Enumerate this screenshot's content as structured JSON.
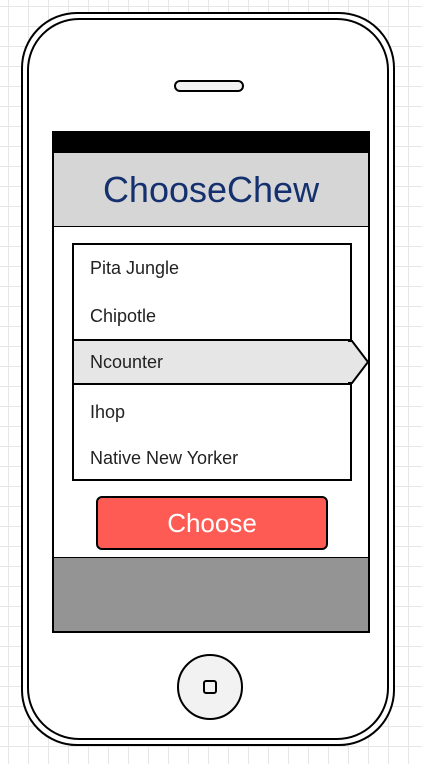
{
  "app": {
    "title": "ChooseChew"
  },
  "picker": {
    "items": [
      {
        "label": "Pita Jungle",
        "selected": false
      },
      {
        "label": "Chipotle",
        "selected": false
      },
      {
        "label": "Ncounter",
        "selected": true
      },
      {
        "label": "Ihop",
        "selected": false
      },
      {
        "label": "Native New Yorker",
        "selected": false
      }
    ]
  },
  "choose_button": {
    "label": "Choose"
  },
  "colors": {
    "title_text": "#14306e",
    "header_bg": "#d6d6d6",
    "button_bg": "#ff5b55",
    "button_text": "#ffffff",
    "selected_row_bg": "#e6e6e6",
    "bottom_bar_bg": "#949494",
    "status_bar_bg": "#000000"
  },
  "icons": {
    "selection_indicator": "arrow-pointer-icon",
    "home": "home-square-icon",
    "speaker": "speaker-slot-icon"
  }
}
